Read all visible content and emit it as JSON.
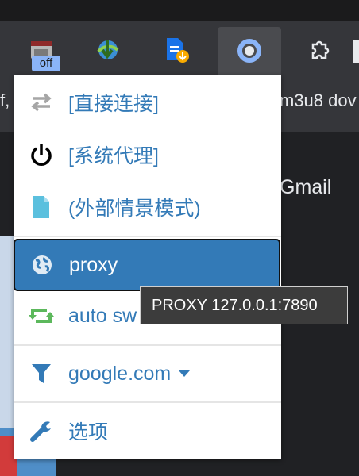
{
  "toolbar": {
    "extensions": [
      {
        "name": "extension-off",
        "badge": "off"
      },
      {
        "name": "download-manager"
      },
      {
        "name": "file-downloader"
      },
      {
        "name": "proxy-switcher",
        "active": true
      },
      {
        "name": "extensions-puzzle"
      }
    ]
  },
  "bookmarks": {
    "left_fragment": "f, ",
    "right_fragment": "m3u8 dov"
  },
  "page": {
    "gmail_text": "Gmail"
  },
  "menu": {
    "items": [
      {
        "label": "[直接连接]",
        "icon": "swap-arrows-icon"
      },
      {
        "label": "[系统代理]",
        "icon": "power-icon"
      },
      {
        "label": "(外部情景模式)",
        "icon": "file-icon"
      },
      {
        "label": "proxy",
        "icon": "globe-icon",
        "selected": true
      },
      {
        "label": "auto sw",
        "icon": "retweet-icon"
      },
      {
        "label": "google.com",
        "icon": "filter-icon",
        "dropdown": true
      },
      {
        "label": "选项",
        "icon": "wrench-icon"
      }
    ]
  },
  "tooltip": {
    "text": "PROXY 127.0.0.1:7890"
  },
  "colors": {
    "accent": "#337ab7",
    "green": "#5cb85c",
    "file": "#5bc0de"
  }
}
